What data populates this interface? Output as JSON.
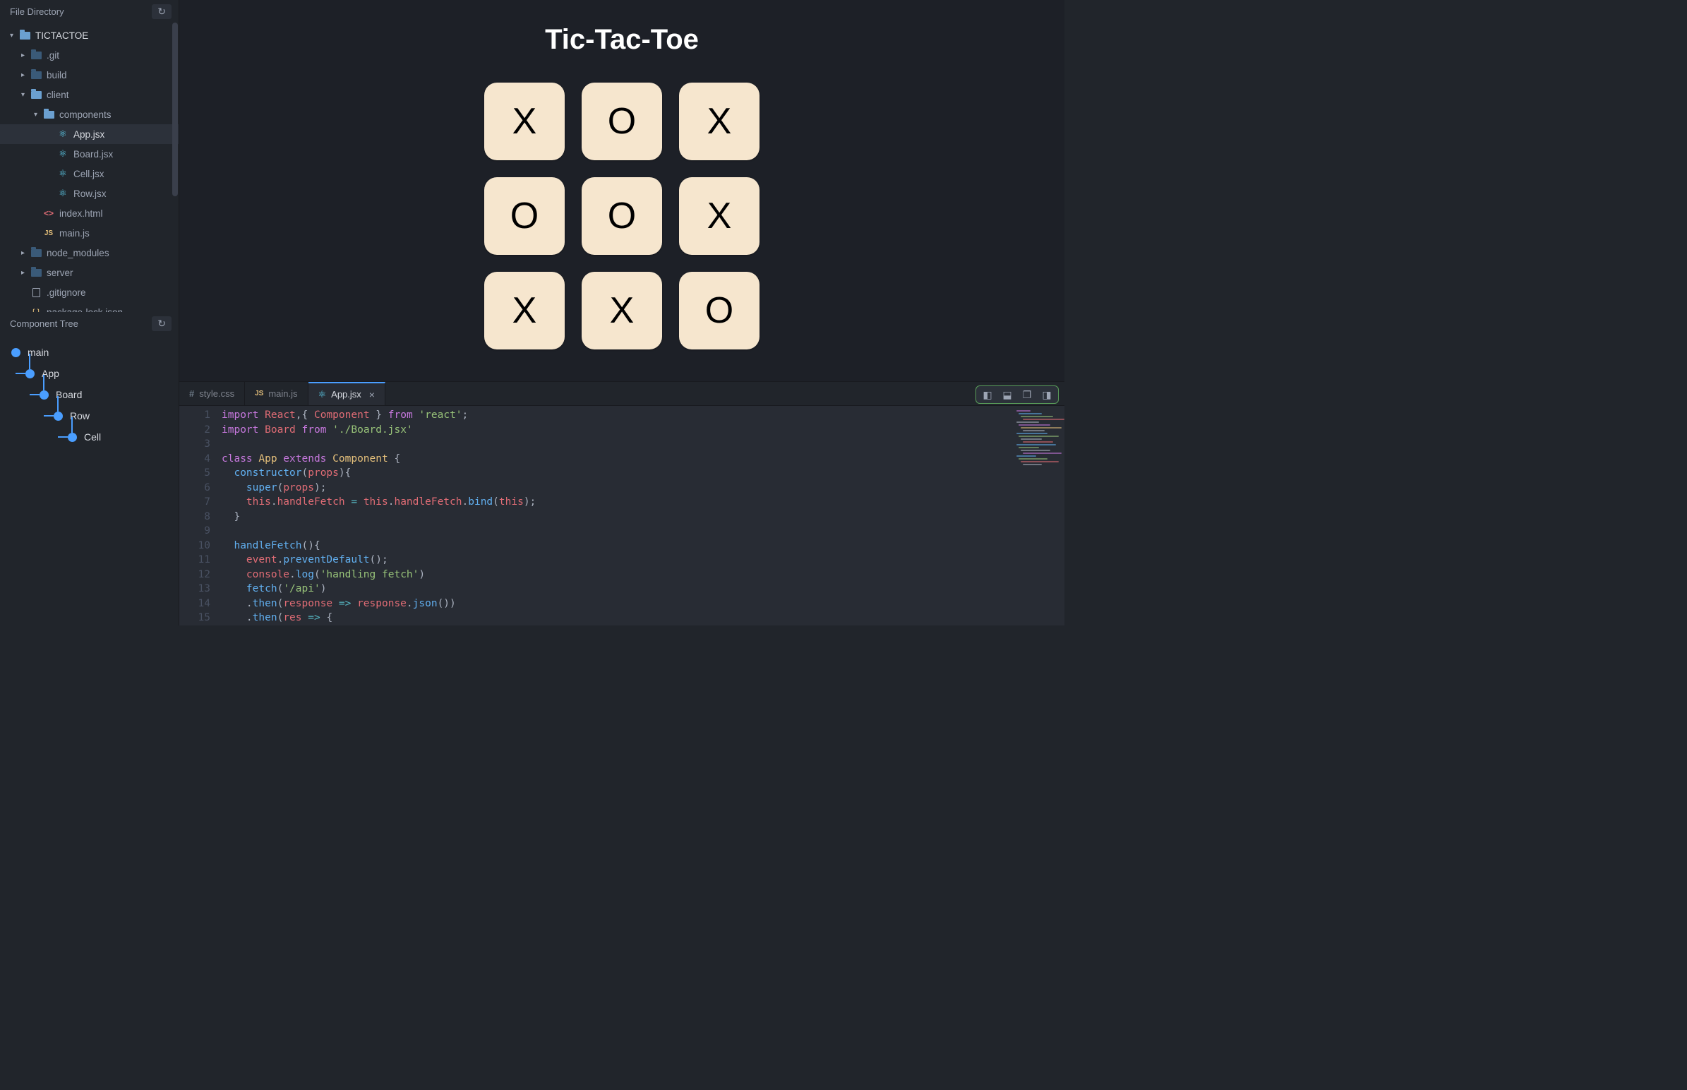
{
  "sidebar": {
    "file_directory_title": "File Directory",
    "refresh_icon": "↻",
    "tree": [
      {
        "name": "TICTACTOE",
        "type": "folder-root",
        "indent": 0,
        "caret": "▾",
        "open": true
      },
      {
        "name": ".git",
        "type": "folder",
        "indent": 1,
        "caret": "▸",
        "dim": true
      },
      {
        "name": "build",
        "type": "folder",
        "indent": 1,
        "caret": "▸",
        "dim": true
      },
      {
        "name": "client",
        "type": "folder",
        "indent": 1,
        "caret": "▾",
        "open": true
      },
      {
        "name": "components",
        "type": "folder",
        "indent": 2,
        "caret": "▾",
        "open": true
      },
      {
        "name": "App.jsx",
        "type": "react",
        "indent": 3,
        "selected": true
      },
      {
        "name": "Board.jsx",
        "type": "react",
        "indent": 3
      },
      {
        "name": "Cell.jsx",
        "type": "react",
        "indent": 3
      },
      {
        "name": "Row.jsx",
        "type": "react",
        "indent": 3
      },
      {
        "name": "index.html",
        "type": "html",
        "indent": 2
      },
      {
        "name": "main.js",
        "type": "js",
        "indent": 2
      },
      {
        "name": "node_modules",
        "type": "folder",
        "indent": 1,
        "caret": "▸",
        "dim": true
      },
      {
        "name": "server",
        "type": "folder",
        "indent": 1,
        "caret": "▸",
        "dim": true
      },
      {
        "name": ".gitignore",
        "type": "file",
        "indent": 1
      },
      {
        "name": "package-lock.json",
        "type": "json",
        "indent": 1
      }
    ],
    "component_tree_title": "Component Tree",
    "component_tree": [
      {
        "name": "main",
        "indent": 0
      },
      {
        "name": "App",
        "indent": 1
      },
      {
        "name": "Board",
        "indent": 2
      },
      {
        "name": "Row",
        "indent": 3
      },
      {
        "name": "Cell",
        "indent": 4
      }
    ]
  },
  "preview": {
    "title": "Tic-Tac-Toe",
    "board": [
      [
        "X",
        "O",
        "X"
      ],
      [
        "O",
        "O",
        "X"
      ],
      [
        "X",
        "X",
        "O"
      ]
    ]
  },
  "editor": {
    "tabs": [
      {
        "label": "style.css",
        "icon": "hash",
        "active": false
      },
      {
        "label": "main.js",
        "icon": "js",
        "active": false
      },
      {
        "label": "App.jsx",
        "icon": "react",
        "active": true,
        "closable": true
      }
    ],
    "pane_controls": [
      "panel-left",
      "panel-bottom",
      "panel-multi",
      "panel-right"
    ],
    "lines": [
      [
        [
          "kw",
          "import"
        ],
        [
          "",
          " "
        ],
        [
          "id",
          "React"
        ],
        [
          "punc",
          ",{ "
        ],
        [
          "id",
          "Component"
        ],
        [
          "punc",
          " } "
        ],
        [
          "kw",
          "from"
        ],
        [
          "",
          ""
        ],
        [
          "str",
          " 'react'"
        ],
        [
          "punc",
          ";"
        ]
      ],
      [
        [
          "kw",
          "import"
        ],
        [
          "",
          ""
        ],
        [
          "id",
          " Board"
        ],
        [
          "",
          ""
        ],
        [
          "kw",
          " from"
        ],
        [
          "",
          ""
        ],
        [
          "str",
          " './Board.jsx'"
        ]
      ],
      [],
      [
        [
          "kw",
          "class"
        ],
        [
          "",
          ""
        ],
        [
          "cls",
          " App"
        ],
        [
          "",
          ""
        ],
        [
          "kw",
          " extends"
        ],
        [
          "",
          ""
        ],
        [
          "cls",
          " Component"
        ],
        [
          "punc",
          " {"
        ]
      ],
      [
        [
          "",
          ""
        ],
        [
          "",
          "  "
        ],
        [
          "fn",
          "constructor"
        ],
        [
          "punc",
          "("
        ],
        [
          "id",
          "props"
        ],
        [
          "punc",
          "){"
        ]
      ],
      [
        [
          "",
          "    "
        ],
        [
          "fn",
          "super"
        ],
        [
          "punc",
          "("
        ],
        [
          "id",
          "props"
        ],
        [
          "punc",
          ");"
        ]
      ],
      [
        [
          "",
          "    "
        ],
        [
          "this",
          "this"
        ],
        [
          "punc",
          "."
        ],
        [
          "prop",
          "handleFetch"
        ],
        [
          "op",
          " = "
        ],
        [
          "this",
          "this"
        ],
        [
          "punc",
          "."
        ],
        [
          "prop",
          "handleFetch"
        ],
        [
          "punc",
          "."
        ],
        [
          "fn",
          "bind"
        ],
        [
          "punc",
          "("
        ],
        [
          "this",
          "this"
        ],
        [
          "punc",
          ");"
        ]
      ],
      [
        [
          "",
          "  "
        ],
        [
          "punc",
          "}"
        ]
      ],
      [],
      [
        [
          "",
          "  "
        ],
        [
          "fn",
          "handleFetch"
        ],
        [
          "punc",
          "(){"
        ]
      ],
      [
        [
          "",
          "    "
        ],
        [
          "id",
          "event"
        ],
        [
          "punc",
          "."
        ],
        [
          "fn",
          "preventDefault"
        ],
        [
          "punc",
          "();"
        ]
      ],
      [
        [
          "",
          "    "
        ],
        [
          "id",
          "console"
        ],
        [
          "punc",
          "."
        ],
        [
          "fn",
          "log"
        ],
        [
          "punc",
          "("
        ],
        [
          "str",
          "'handling fetch'"
        ],
        [
          "punc",
          ")"
        ]
      ],
      [
        [
          "",
          "    "
        ],
        [
          "fn",
          "fetch"
        ],
        [
          "punc",
          "("
        ],
        [
          "str",
          "'/api'"
        ],
        [
          "punc",
          ")"
        ]
      ],
      [
        [
          "",
          "    ."
        ],
        [
          "fn",
          "then"
        ],
        [
          "punc",
          "("
        ],
        [
          "id",
          "response"
        ],
        [
          "op",
          " => "
        ],
        [
          "id",
          "response"
        ],
        [
          "punc",
          "."
        ],
        [
          "fn",
          "json"
        ],
        [
          "punc",
          "())"
        ]
      ],
      [
        [
          "",
          "    ."
        ],
        [
          "fn",
          "then"
        ],
        [
          "punc",
          "("
        ],
        [
          "id",
          "res"
        ],
        [
          "op",
          " => "
        ],
        [
          "punc",
          "{"
        ]
      ]
    ]
  }
}
